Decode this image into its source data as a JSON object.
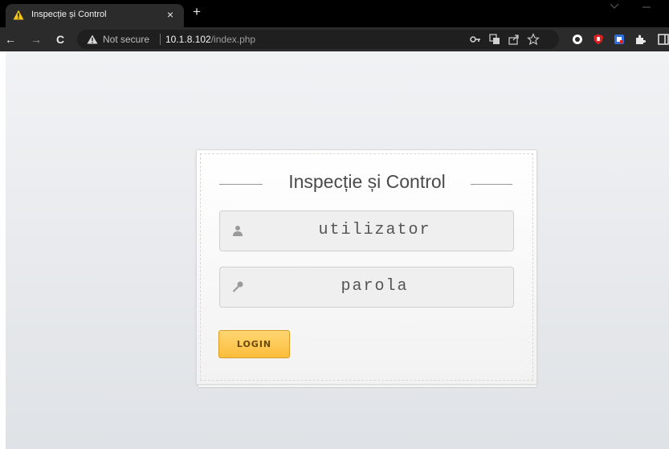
{
  "browser": {
    "tab": {
      "title": "Inspecție și Control",
      "close_glyph": "×",
      "icon": "warning-icon"
    },
    "new_tab_glyph": "+",
    "nav": {
      "back_glyph": "←",
      "forward_glyph": "→",
      "reload_glyph": "C"
    },
    "address_bar": {
      "security_label": "Not secure",
      "security_icon": "warning-icon",
      "url_host": "10.1.8.102",
      "url_path": "/index.php"
    },
    "omnibox_icons": [
      "key-icon",
      "translate-icon",
      "share-icon",
      "bookmark-star-icon"
    ],
    "extension_icons": [
      "circle-extension-icon",
      "red-shield-extension-icon",
      "blue-extension-icon",
      "puzzle-extensions-icon"
    ]
  },
  "login": {
    "title": "Inspecție și Control",
    "username_placeholder": "utilizator",
    "password_placeholder": "parola",
    "login_button": "LOGIN"
  },
  "colors": {
    "tab_bar": "#000000",
    "toolbar": "#2b2b2b",
    "warning": "#f5c518",
    "login_button": "#fbc14a",
    "page_background": "#e6e8eb"
  }
}
